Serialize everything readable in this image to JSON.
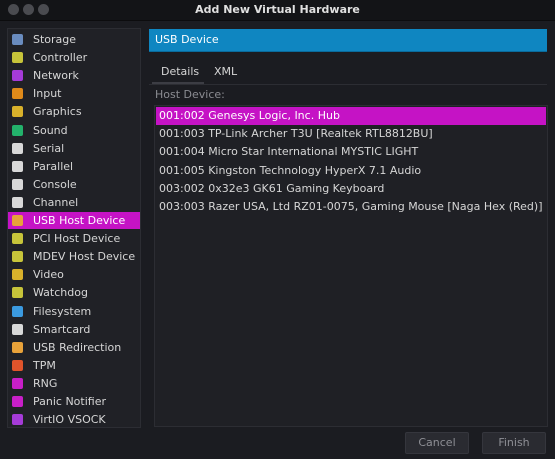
{
  "window": {
    "title": "Add New Virtual Hardware"
  },
  "sidebar": {
    "items": [
      {
        "label": "Storage",
        "icon": "storage-icon",
        "color": "#6a8cbf"
      },
      {
        "label": "Controller",
        "icon": "controller-icon",
        "color": "#c7c43a"
      },
      {
        "label": "Network",
        "icon": "network-icon",
        "color": "#a63bd8"
      },
      {
        "label": "Input",
        "icon": "input-icon",
        "color": "#e08a1a"
      },
      {
        "label": "Graphics",
        "icon": "graphics-icon",
        "color": "#d9b12b"
      },
      {
        "label": "Sound",
        "icon": "sound-icon",
        "color": "#23b26b"
      },
      {
        "label": "Serial",
        "icon": "serial-icon",
        "color": "#d8d8d8"
      },
      {
        "label": "Parallel",
        "icon": "parallel-icon",
        "color": "#d8d8d8"
      },
      {
        "label": "Console",
        "icon": "console-icon",
        "color": "#d8d8d8"
      },
      {
        "label": "Channel",
        "icon": "channel-icon",
        "color": "#d8d8d8"
      },
      {
        "label": "USB Host Device",
        "icon": "usb-host-icon",
        "color": "#e8a23a"
      },
      {
        "label": "PCI Host Device",
        "icon": "pci-host-icon",
        "color": "#c7c43a"
      },
      {
        "label": "MDEV Host Device",
        "icon": "mdev-host-icon",
        "color": "#c7c43a"
      },
      {
        "label": "Video",
        "icon": "video-icon",
        "color": "#d9b12b"
      },
      {
        "label": "Watchdog",
        "icon": "watchdog-icon",
        "color": "#c7c43a"
      },
      {
        "label": "Filesystem",
        "icon": "filesystem-icon",
        "color": "#3b9ae0"
      },
      {
        "label": "Smartcard",
        "icon": "smartcard-icon",
        "color": "#d8d8d8"
      },
      {
        "label": "USB Redirection",
        "icon": "usb-redirection-icon",
        "color": "#e8a23a"
      },
      {
        "label": "TPM",
        "icon": "tpm-icon",
        "color": "#e0542b"
      },
      {
        "label": "RNG",
        "icon": "rng-icon",
        "color": "#c81fc8"
      },
      {
        "label": "Panic Notifier",
        "icon": "panic-notifier-icon",
        "color": "#c81fc8"
      },
      {
        "label": "VirtIO VSOCK",
        "icon": "vsock-icon",
        "color": "#a63bd8"
      }
    ],
    "selected_index": 10
  },
  "main": {
    "header": "USB Device",
    "tabs": [
      "Details",
      "XML"
    ],
    "active_tab": "Details",
    "host_device_label": "Host Device:",
    "devices": [
      "001:002 Genesys Logic, Inc. Hub",
      "001:003 TP-Link Archer T3U [Realtek RTL8812BU]",
      "001:004 Micro Star International MYSTIC LIGHT",
      "001:005 Kingston Technology HyperX 7.1 Audio",
      "003:002 0x32e3 GK61 Gaming Keyboard",
      "003:003 Razer USA, Ltd RZ01-0075, Gaming Mouse [Naga Hex (Red)]"
    ],
    "selected_device": 0
  },
  "buttons": {
    "cancel": "Cancel",
    "finish": "Finish"
  },
  "colors": {
    "accent": "#c513c5",
    "header": "#0f86c1"
  }
}
